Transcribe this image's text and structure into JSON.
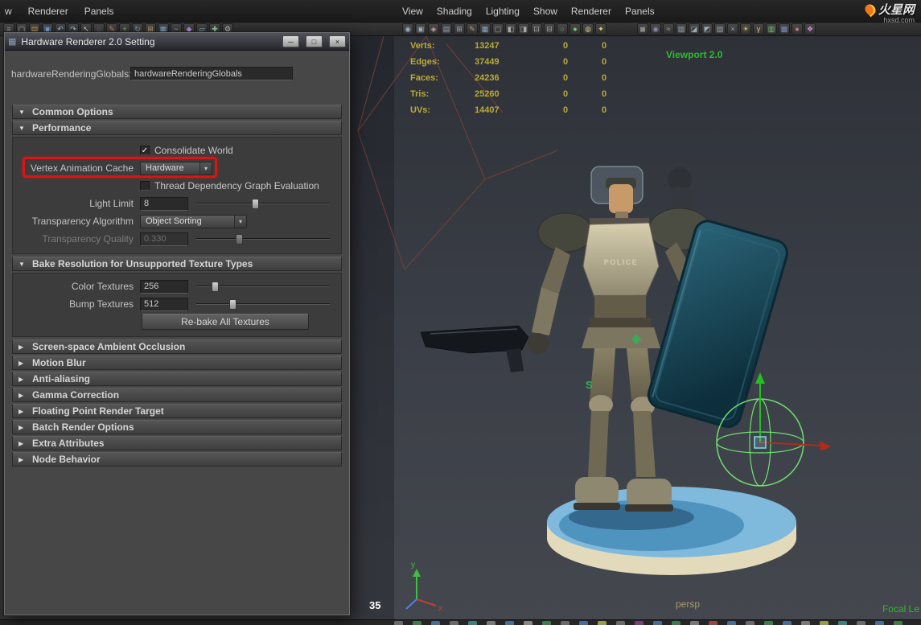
{
  "glyphs": {
    "expanded_arrow": "▼",
    "collapsed_arrow": "▶",
    "dropdown_arrow": "▾",
    "check": "✓",
    "minimize": "─",
    "maximize": "□",
    "close": "×"
  },
  "menubar": {
    "left_items": [
      {
        "label": "w",
        "name": "menu-window"
      },
      {
        "label": "Renderer",
        "name": "menu-renderer"
      },
      {
        "label": "Panels",
        "name": "menu-panels"
      }
    ],
    "panel_menu": [
      {
        "label": "View",
        "name": "menu-view"
      },
      {
        "label": "Shading",
        "name": "menu-shading"
      },
      {
        "label": "Lighting",
        "name": "menu-lighting"
      },
      {
        "label": "Show",
        "name": "menu-show"
      },
      {
        "label": "Renderer",
        "name": "menu-renderer-panel"
      },
      {
        "label": "Panels",
        "name": "menu-panels-panel"
      }
    ],
    "logo_text": "火星网",
    "logo_sub": "hxsd.com"
  },
  "toolbar": {
    "left_icons": [
      {
        "name": "menu-grip-icon",
        "glyph": "≡",
        "color": "#9a9a9a"
      },
      {
        "name": "new-scene-icon",
        "glyph": "▢",
        "color": "#b8b8b8"
      },
      {
        "name": "open-scene-icon",
        "glyph": "▤",
        "color": "#c9a14a"
      },
      {
        "name": "save-scene-icon",
        "glyph": "▣",
        "color": "#7aa4d8"
      },
      {
        "name": "undo-icon",
        "glyph": "↶",
        "color": "#a8c4e0"
      },
      {
        "name": "redo-icon",
        "glyph": "↷",
        "color": "#a8c4e0"
      },
      {
        "name": "select-tool-icon",
        "glyph": "↖",
        "color": "#d0d0d0"
      },
      {
        "name": "lasso-tool-icon",
        "glyph": "◌",
        "color": "#d0d0d0"
      },
      {
        "name": "paint-select-icon",
        "glyph": "✎",
        "color": "#d08a6a"
      },
      {
        "name": "move-tool-icon",
        "glyph": "+",
        "color": "#7ac87a"
      },
      {
        "name": "rotate-tool-icon",
        "glyph": "↻",
        "color": "#7a9ac8"
      },
      {
        "name": "scale-tool-icon",
        "glyph": "⊞",
        "color": "#c8a27a"
      },
      {
        "name": "snap-grid-icon",
        "glyph": "▦",
        "color": "#8ab4d8"
      },
      {
        "name": "snap-curve-icon",
        "glyph": "~",
        "color": "#8ab4d8"
      },
      {
        "name": "snap-point-icon",
        "glyph": "◆",
        "color": "#b08ad8"
      },
      {
        "name": "snap-plane-icon",
        "glyph": "▱",
        "color": "#8ab4d8"
      },
      {
        "name": "construction-history-icon",
        "glyph": "✚",
        "color": "#9ac89a"
      },
      {
        "name": "render-settings-icon",
        "glyph": "⚙",
        "color": "#c0c0c0"
      }
    ],
    "mid_icons": [
      {
        "name": "select-camera-icon",
        "glyph": "◉",
        "color": "#99aabb"
      },
      {
        "name": "camera-attributes-icon",
        "glyph": "▣",
        "color": "#99aabb"
      },
      {
        "name": "bookmark-icon",
        "glyph": "◈",
        "color": "#cc99aa"
      },
      {
        "name": "image-plane-icon",
        "glyph": "▤",
        "color": "#99aabb"
      },
      {
        "name": "pan-zoom-icon",
        "glyph": "⊞",
        "color": "#99aabb"
      },
      {
        "name": "grease-pencil-icon",
        "glyph": "✎",
        "color": "#cc9966"
      },
      {
        "name": "grid-icon",
        "glyph": "▦",
        "color": "#88aacc"
      },
      {
        "name": "film-gate-icon",
        "glyph": "▢",
        "color": "#aaaaaa"
      },
      {
        "name": "resolution-gate-icon",
        "glyph": "◧",
        "color": "#aaaaaa"
      },
      {
        "name": "gate-mask-icon",
        "glyph": "◨",
        "color": "#aaaaaa"
      },
      {
        "name": "safe-action-icon",
        "glyph": "⊡",
        "color": "#aaaaaa"
      },
      {
        "name": "safe-title-icon",
        "glyph": "⊟",
        "color": "#aaaaaa"
      },
      {
        "name": "wireframe-mode-icon",
        "glyph": "○",
        "color": "#7ac87a"
      },
      {
        "name": "shaded-mode-icon",
        "glyph": "●",
        "color": "#7ac87a"
      },
      {
        "name": "textured-mode-icon",
        "glyph": "◍",
        "color": "#c8c87a"
      },
      {
        "name": "lights-icon",
        "glyph": "✦",
        "color": "#e0d070"
      }
    ],
    "right_icons": [
      {
        "name": "shadows-icon",
        "glyph": "◼",
        "color": "#888888"
      },
      {
        "name": "screen-ao-icon",
        "glyph": "◉",
        "color": "#8888aa"
      },
      {
        "name": "motion-blur-icon",
        "glyph": "≈",
        "color": "#99aabb"
      },
      {
        "name": "multisample-icon",
        "glyph": "▨",
        "color": "#99aabb"
      },
      {
        "name": "depth-peel-icon",
        "glyph": "◪",
        "color": "#99aabb"
      },
      {
        "name": "isolate-select-icon",
        "glyph": "◩",
        "color": "#99aabb"
      },
      {
        "name": "xray-icon",
        "glyph": "▧",
        "color": "#99aabb"
      },
      {
        "name": "joints-xray-icon",
        "glyph": "×",
        "color": "#99aabb"
      },
      {
        "name": "exposure-icon",
        "glyph": "☀",
        "color": "#e0c060"
      },
      {
        "name": "gamma-icon",
        "glyph": "γ",
        "color": "#e0c060"
      },
      {
        "name": "view-cube-icon",
        "glyph": "▥",
        "color": "#78c878"
      },
      {
        "name": "poly-cube-icon",
        "glyph": "▩",
        "color": "#7890c8"
      },
      {
        "name": "material-ball-icon",
        "glyph": "●",
        "color": "#c87890"
      },
      {
        "name": "paint-effects-icon",
        "glyph": "❖",
        "color": "#c890e0"
      }
    ]
  },
  "dialog": {
    "title": "Hardware Renderer 2.0 Setting",
    "globals_label": "hardwareRenderingGlobals:",
    "globals_value": "hardwareRenderingGlobals",
    "common_options_label": "Common Options",
    "performance": {
      "label": "Performance",
      "consolidate_world": {
        "label": "Consolidate World",
        "checked": true
      },
      "vertex_anim": {
        "label": "Vertex Animation Cache",
        "value": "Hardware"
      },
      "thread_dep": {
        "label": "Thread Dependency Graph Evaluation",
        "checked": false
      },
      "light_limit": {
        "label": "Light Limit",
        "value": "8",
        "slider_pct": 44
      },
      "transparency_algorithm": {
        "label": "Transparency Algorithm",
        "value": "Object Sorting"
      },
      "transparency_quality": {
        "label": "Transparency Quality",
        "value": "0.330",
        "slider_pct": 32,
        "disabled": true
      }
    },
    "bake": {
      "label": "Bake Resolution for Unsupported Texture Types",
      "color_textures": {
        "label": "Color Textures",
        "value": "256",
        "slider_pct": 14
      },
      "bump_textures": {
        "label": "Bump Textures",
        "value": "512",
        "slider_pct": 27
      },
      "rebake_button": "Re-bake All Textures"
    },
    "collapsed_sections": [
      {
        "label": "Screen-space Ambient Occlusion",
        "name": "section-screen-space-ambient-occlusion"
      },
      {
        "label": "Motion Blur",
        "name": "section-motion-blur"
      },
      {
        "label": "Anti-aliasing",
        "name": "section-anti-aliasing"
      },
      {
        "label": "Gamma Correction",
        "name": "section-gamma-correction"
      },
      {
        "label": "Floating Point Render Target",
        "name": "section-floating-point-render-target"
      },
      {
        "label": "Batch Render Options",
        "name": "section-batch-render-options"
      },
      {
        "label": "Extra Attributes",
        "name": "section-extra-attributes"
      },
      {
        "label": "Node Behavior",
        "name": "section-node-behavior"
      }
    ]
  },
  "viewport": {
    "hud_rows": [
      {
        "label": "Verts:",
        "v1": "13247",
        "v2": "0",
        "v3": "0"
      },
      {
        "label": "Edges:",
        "v1": "37449",
        "v2": "0",
        "v3": "0"
      },
      {
        "label": "Faces:",
        "v1": "24236",
        "v2": "0",
        "v3": "0"
      },
      {
        "label": "Tris:",
        "v1": "25260",
        "v2": "0",
        "v3": "0"
      },
      {
        "label": "UVs:",
        "v1": "14407",
        "v2": "0",
        "v3": "0"
      }
    ],
    "renderer_label": "Viewport 2.0",
    "camera_label": "persp",
    "focal_label": "Focal Le",
    "frame_annotation": "35",
    "model_chest_text": "POLICE",
    "model_thigh_text": "S",
    "axis": {
      "x_label": "x",
      "y_label": "y"
    }
  },
  "bottombar": {
    "icons": [
      {
        "name": "shelf-icon",
        "color": "#777777"
      },
      {
        "name": "shelf-icon",
        "color": "#3f8f4f"
      },
      {
        "name": "shelf-icon",
        "color": "#4a7ab0"
      },
      {
        "name": "shelf-icon",
        "color": "#777777"
      },
      {
        "name": "shelf-icon",
        "color": "#3f8f8f"
      },
      {
        "name": "shelf-icon",
        "color": "#888888"
      },
      {
        "name": "shelf-icon",
        "color": "#4a7ab0"
      },
      {
        "name": "shelf-icon",
        "color": "#999999"
      },
      {
        "name": "shelf-icon",
        "color": "#3f8f4f"
      },
      {
        "name": "shelf-icon",
        "color": "#777777"
      },
      {
        "name": "shelf-icon",
        "color": "#4a7ab0"
      },
      {
        "name": "shelf-icon",
        "color": "#b0b04a"
      },
      {
        "name": "shelf-icon",
        "color": "#777777"
      },
      {
        "name": "shelf-icon",
        "color": "#8f3f8f"
      },
      {
        "name": "shelf-icon",
        "color": "#4a7ab0"
      },
      {
        "name": "shelf-icon",
        "color": "#3f8f4f"
      },
      {
        "name": "shelf-icon",
        "color": "#888888"
      },
      {
        "name": "shelf-icon",
        "color": "#b04a4a"
      },
      {
        "name": "shelf-icon",
        "color": "#4a7ab0"
      },
      {
        "name": "shelf-icon",
        "color": "#777777"
      },
      {
        "name": "shelf-icon",
        "color": "#3f8f4f"
      },
      {
        "name": "shelf-icon",
        "color": "#4a7ab0"
      },
      {
        "name": "shelf-icon",
        "color": "#888888"
      },
      {
        "name": "shelf-icon",
        "color": "#b0b04a"
      },
      {
        "name": "shelf-icon",
        "color": "#3f8f8f"
      },
      {
        "name": "shelf-icon",
        "color": "#777777"
      },
      {
        "name": "shelf-icon",
        "color": "#4a7ab0"
      },
      {
        "name": "shelf-icon",
        "color": "#3f8f4f"
      }
    ]
  }
}
